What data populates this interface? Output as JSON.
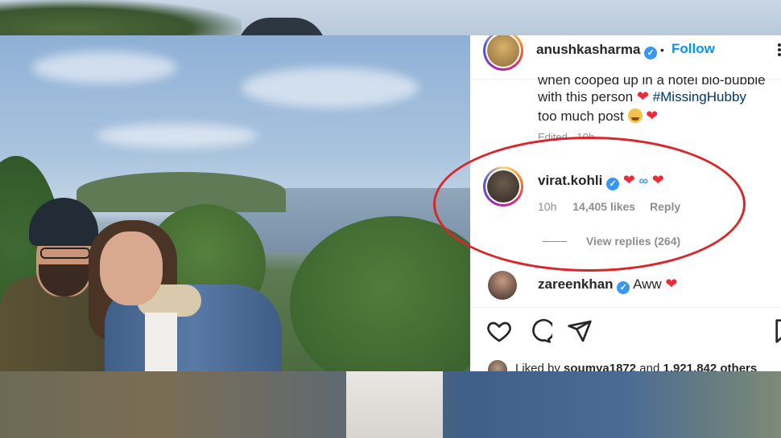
{
  "post": {
    "author": {
      "username": "anushkasharma",
      "verified_mark": "✓",
      "separator": "•",
      "follow_label": "Follow"
    },
    "caption": {
      "line1": "when cooped up in a hotel bio-bubble",
      "line2_text": "with this person",
      "line2_hashtag": "#MissingHubby",
      "line3_text": "too much post"
    },
    "edited": "Edited · 10h",
    "heart": "❤"
  },
  "comments": [
    {
      "username": "virat.kohli",
      "verified_mark": "✓",
      "text_heart1": "❤",
      "text_infinity": "∞",
      "text_heart2": "❤",
      "time": "10h",
      "likes": "14,405 likes",
      "reply_label": "Reply",
      "view_replies": "View replies (264)"
    },
    {
      "username": "zareenkhan",
      "verified_mark": "✓",
      "text": "Aww",
      "text_heart": "❤"
    }
  ],
  "actions": {
    "icons": [
      "heart-outline-icon",
      "comment-icon",
      "share-icon",
      "bookmark-icon"
    ]
  },
  "liked_by": {
    "prefix": "Liked by",
    "user": "soumya1872",
    "middle": "and",
    "count": "1,921,842",
    "suffix": "others"
  },
  "colors": {
    "highlight": "#d9262b",
    "link": "#0095f6",
    "hashtag": "#00376b",
    "heart": "#ed2a3a",
    "verified": "#3897f0"
  }
}
